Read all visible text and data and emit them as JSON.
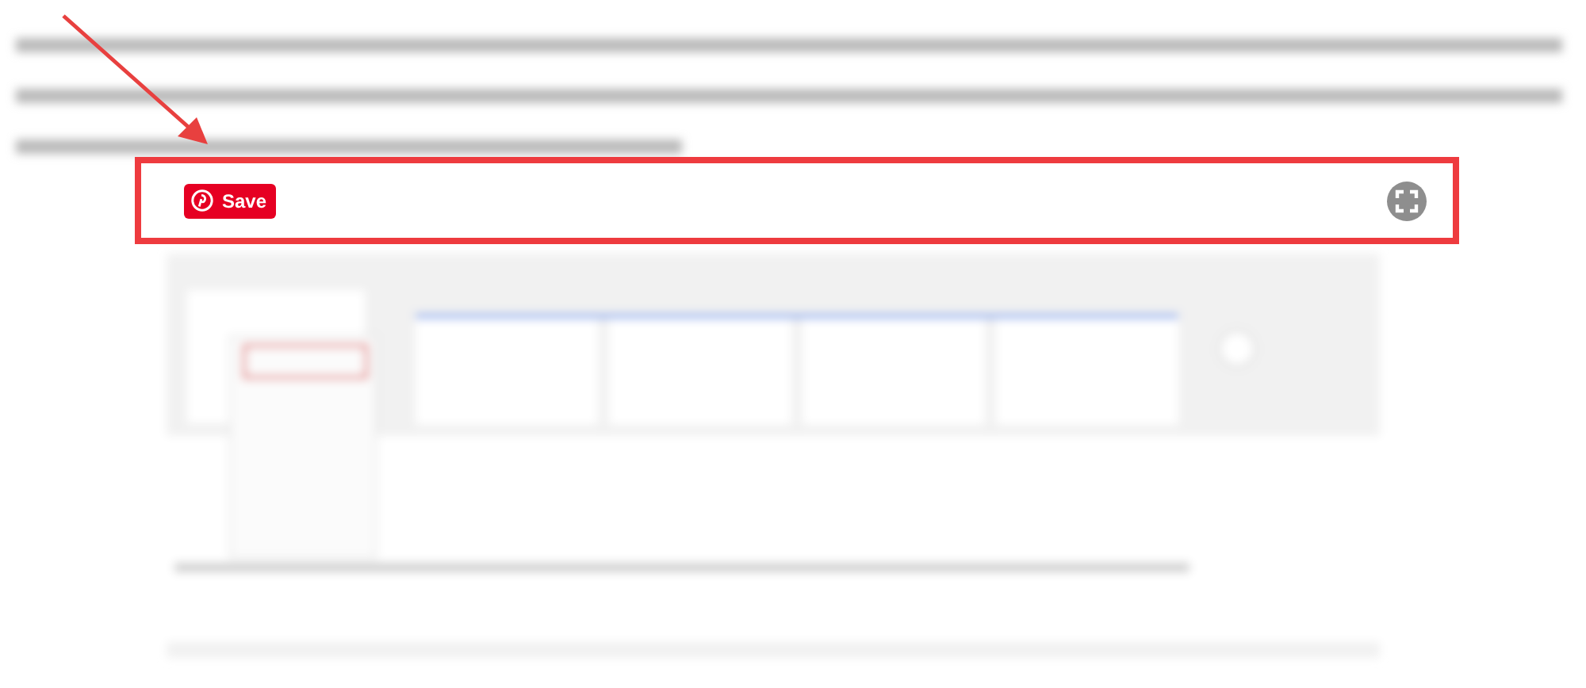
{
  "pin_overlay": {
    "save_button": {
      "label": "Save"
    }
  }
}
